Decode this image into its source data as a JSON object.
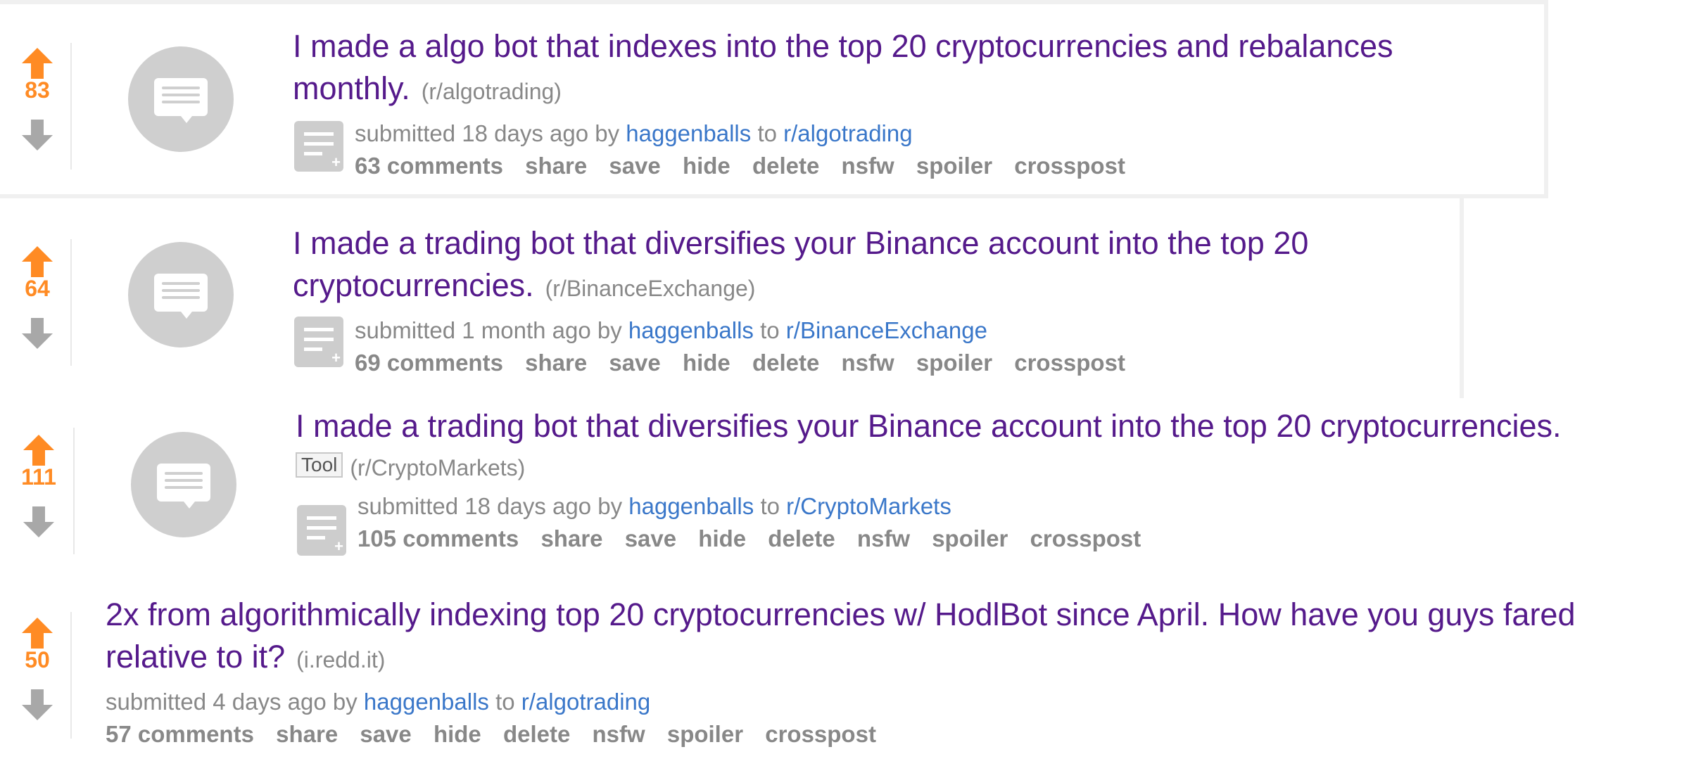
{
  "posts": [
    {
      "score": "83",
      "title": "I made a algo bot that indexes into the top 20 cryptocurrencies and rebalances",
      "title_cont": "monthly.",
      "domain": "(r/algotrading)",
      "flair": "",
      "submitted_prefix": "submitted",
      "time": "18 days ago",
      "by": "by",
      "author": "haggenballs",
      "to": "to",
      "subreddit": "r/algotrading",
      "comments": "63 comments"
    },
    {
      "score": "64",
      "title": "I made a trading bot that diversifies your Binance account into the top 20",
      "title_cont": "cryptocurrencies.",
      "domain": "(r/BinanceExchange)",
      "flair": "",
      "submitted_prefix": "submitted",
      "time": "1 month ago",
      "by": "by",
      "author": "haggenballs",
      "to": "to",
      "subreddit": "r/BinanceExchange",
      "comments": "69 comments"
    },
    {
      "score": "111",
      "title": "I made a trading bot that diversifies your Binance account into the top 20 cryptocurrencies.",
      "title_cont": "",
      "domain": "(r/CryptoMarkets)",
      "flair": "Tool",
      "submitted_prefix": "submitted",
      "time": "18 days ago",
      "by": "by",
      "author": "haggenballs",
      "to": "to",
      "subreddit": "r/CryptoMarkets",
      "comments": "105 comments"
    },
    {
      "score": "50",
      "title": "2x from algorithmically indexing top 20 cryptocurrencies w/ HodlBot since April. How have you guys fared",
      "title_cont": "relative to it?",
      "domain": "(i.redd.it)",
      "flair": "",
      "submitted_prefix": "submitted",
      "time": "4 days ago",
      "by": "by",
      "author": "haggenballs",
      "to": "to",
      "subreddit": "r/algotrading",
      "comments": "57 comments"
    }
  ],
  "actions": {
    "share": "share",
    "save": "save",
    "hide": "hide",
    "delete": "delete",
    "nsfw": "nsfw",
    "spoiler": "spoiler",
    "crosspost": "crosspost"
  },
  "colors": {
    "upvote": "#ff8b24",
    "title": "#551a8b",
    "link": "#3a77c9",
    "meta": "#888888"
  },
  "icons": {
    "upvote": "upvote-arrow-icon",
    "downvote": "downvote-arrow-icon",
    "thumbnail": "self-post-thumbnail-icon",
    "expando": "expand-text-icon"
  }
}
